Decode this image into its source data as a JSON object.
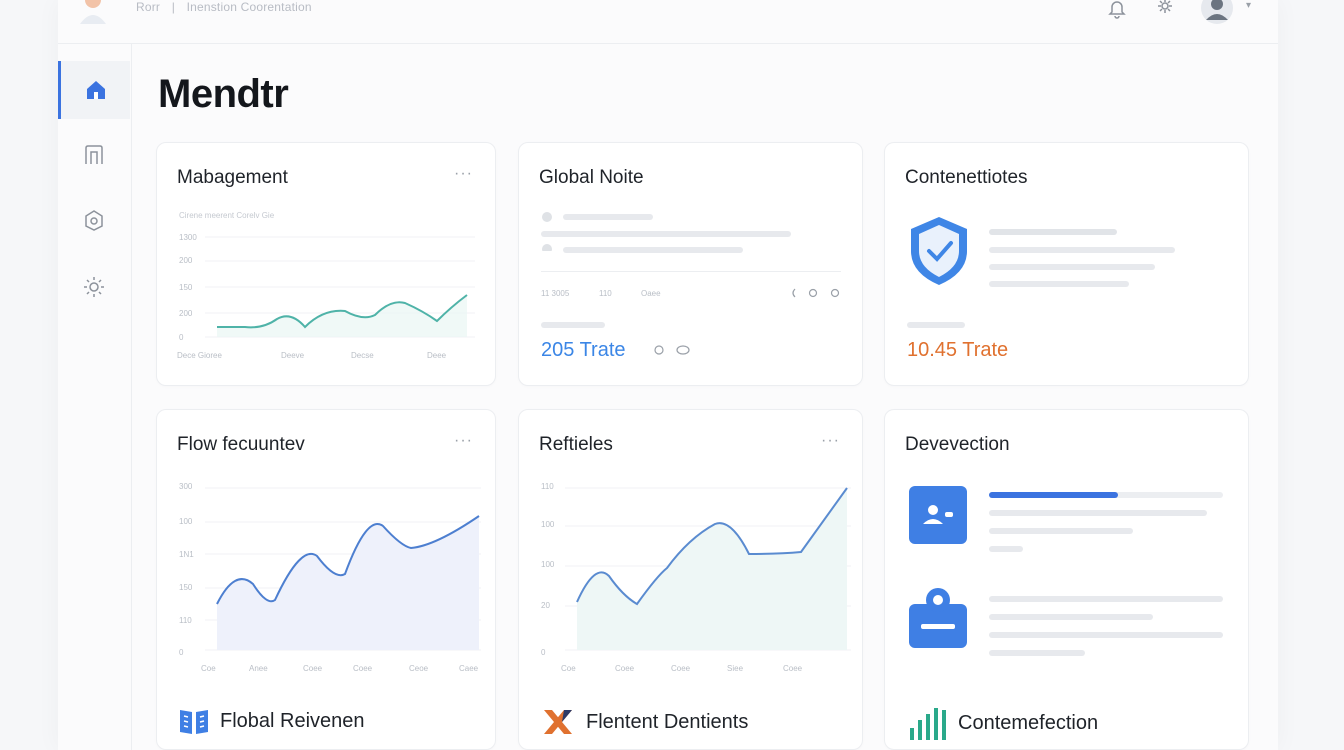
{
  "header": {
    "crumbs": [
      "Rorr",
      "|",
      "Inenstion Coorentation"
    ]
  },
  "sidebar": {
    "items": [
      {
        "icon": "home-icon",
        "active": true
      },
      {
        "icon": "layout-icon",
        "active": false
      },
      {
        "icon": "box-icon",
        "active": false
      },
      {
        "icon": "settings-icon",
        "active": false
      }
    ]
  },
  "page": {
    "title": "Mendtr"
  },
  "cards": {
    "management": {
      "title": "Mabagement",
      "menu": "···",
      "legend_text": "Cirene meerent Corelv Gie",
      "yticks": [
        "1300",
        "200",
        "150",
        "200",
        "0"
      ],
      "xticks": [
        "Dece Gioree",
        "Deeve",
        "Decse",
        "Deee"
      ]
    },
    "global_note": {
      "title": "Global Noite",
      "meta": [
        "11 3005",
        "110",
        "Oaee"
      ],
      "stat": "205 Trate"
    },
    "content_notes": {
      "title": "Contenettiotes",
      "stat": "10.45 Trate"
    },
    "flow": {
      "title": "Flow fecuuntev",
      "menu": "···",
      "yticks": [
        "300",
        "100",
        "1N1",
        "150",
        "110",
        "0"
      ],
      "xticks": [
        "Coe",
        "Anee",
        "Coee",
        "Coee",
        "Ceoe",
        "Caee"
      ]
    },
    "reftieles": {
      "title": "Reftieles",
      "menu": "···",
      "yticks": [
        "110",
        "100",
        "100",
        "20",
        "0"
      ],
      "xticks": [
        "Coe",
        "Coee",
        "Coee",
        "Siee",
        "Coee"
      ]
    },
    "devevection": {
      "title": "Devevection",
      "progress": 0.55
    }
  },
  "footer": {
    "items": [
      {
        "label": "Flobal Reivenen",
        "icon": "book-icon"
      },
      {
        "label": "Flentent Dentients",
        "icon": "cross-icon"
      },
      {
        "label": "Contemefection",
        "icon": "bar-chart-icon"
      }
    ]
  },
  "colors": {
    "accent": "#3b73e0",
    "blue_stat": "#3b86e6",
    "orange_stat": "#e0712f",
    "teal_line": "#4fb3a8",
    "chart_line": "#5a8bd0"
  }
}
